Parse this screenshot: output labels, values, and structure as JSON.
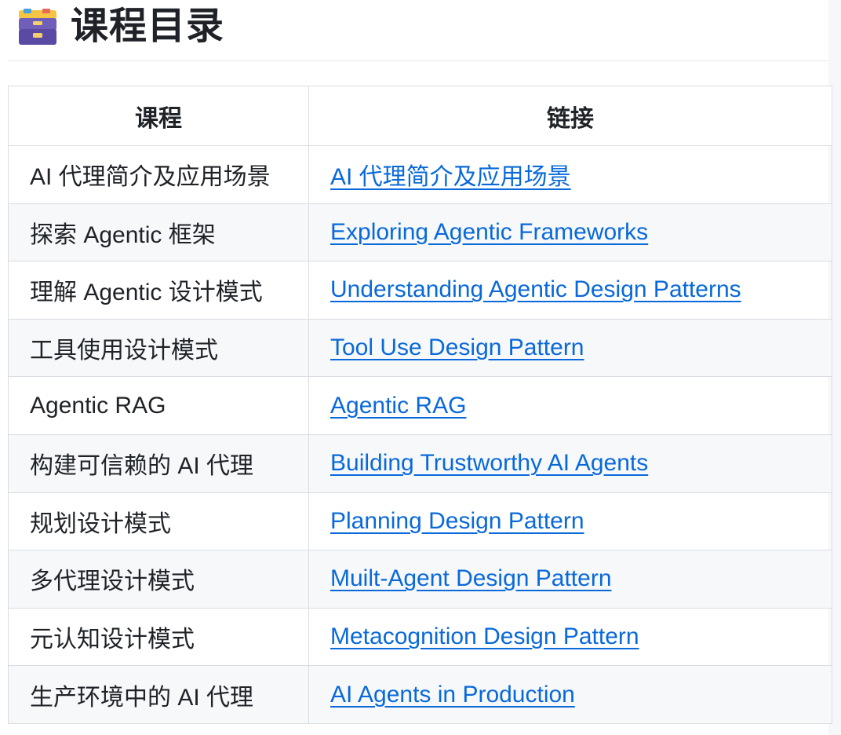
{
  "heading": {
    "title": "课程目录",
    "icon": "card-file-box-icon"
  },
  "table": {
    "headers": {
      "course": "课程",
      "link": "链接"
    },
    "rows": [
      {
        "course": "AI 代理简介及应用场景",
        "link": "AI 代理简介及应用场景"
      },
      {
        "course": "探索 Agentic 框架",
        "link": "Exploring Agentic Frameworks"
      },
      {
        "course": "理解 Agentic 设计模式",
        "link": "Understanding Agentic Design Patterns"
      },
      {
        "course": "工具使用设计模式",
        "link": "Tool Use Design Pattern"
      },
      {
        "course": "Agentic RAG",
        "link": "Agentic RAG"
      },
      {
        "course": "构建可信赖的 AI 代理",
        "link": "Building Trustworthy AI Agents"
      },
      {
        "course": "规划设计模式",
        "link": "Planning Design Pattern"
      },
      {
        "course": "多代理设计模式",
        "link": "Muilt-Agent Design Pattern"
      },
      {
        "course": "元认知设计模式",
        "link": "Metacognition Design Pattern"
      },
      {
        "course": "生产环境中的 AI 代理",
        "link": "AI Agents in Production"
      }
    ]
  },
  "colors": {
    "link": "#0969da",
    "text": "#1f2328",
    "border": "#d8dde3",
    "alt_row": "#f6f8fa"
  }
}
